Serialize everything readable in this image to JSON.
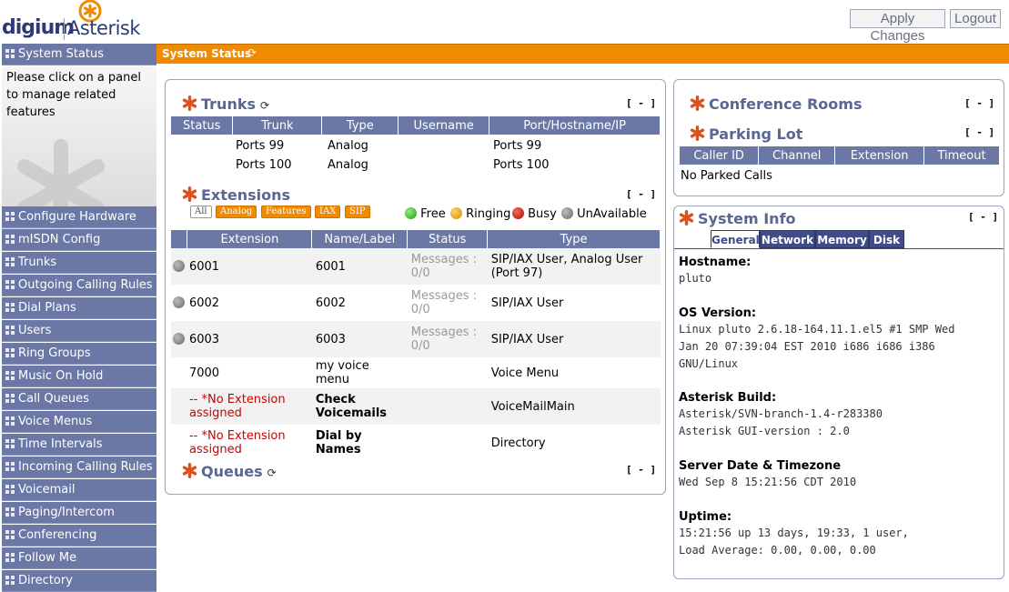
{
  "header": {
    "brand_left": "digium",
    "brand_right": "Asterisk",
    "apply_label": "Apply Changes",
    "logout_label": "Logout"
  },
  "pagebar": {
    "title": "System Status",
    "refresh_icon": "refresh-icon"
  },
  "sidebar": {
    "active": "System Status",
    "info_text": "Please click on a panel to manage related features",
    "items": [
      "Configure Hardware",
      "mISDN Config",
      "Trunks",
      "Outgoing Calling Rules",
      "Dial Plans",
      "Users",
      "Ring Groups",
      "Music On Hold",
      "Call Queues",
      "Voice Menus",
      "Time Intervals",
      "Incoming Calling Rules",
      "Voicemail",
      "Paging/Intercom",
      "Conferencing",
      "Follow Me",
      "Directory"
    ]
  },
  "collapse_label": "[ - ]",
  "trunks": {
    "title": "Trunks",
    "headers": [
      "Status",
      "Trunk",
      "Type",
      "Username",
      "Port/Hostname/IP"
    ],
    "rows": [
      {
        "status": "",
        "trunk": "Ports 99",
        "type": "Analog",
        "username": "",
        "port": "Ports 99"
      },
      {
        "status": "",
        "trunk": "Ports 100",
        "type": "Analog",
        "username": "",
        "port": "Ports 100"
      }
    ]
  },
  "extensions": {
    "title": "Extensions",
    "filters": [
      "All",
      "Analog",
      "Features",
      "IAX",
      "SIP"
    ],
    "legend": [
      "Free",
      "Ringing",
      "Busy",
      "UnAvailable"
    ],
    "headers": [
      "Extension",
      "Name/Label",
      "Status",
      "Type"
    ],
    "rows": [
      {
        "ext": "6001",
        "name": "6001",
        "status": "Messages : 0/0",
        "type": "SIP/IAX User, Analog User (Port 97)"
      },
      {
        "ext": "6002",
        "name": "6002",
        "status": "Messages : 0/0",
        "type": "SIP/IAX User"
      },
      {
        "ext": "6003",
        "name": "6003",
        "status": "Messages : 0/0",
        "type": "SIP/IAX User"
      },
      {
        "ext": "7000",
        "name": "my voice menu",
        "status": "",
        "type": "Voice Menu"
      },
      {
        "ext": "-- *No Extension assigned",
        "name": "Check Voicemails",
        "status": "",
        "type": "VoiceMailMain"
      },
      {
        "ext": "-- *No Extension assigned",
        "name": "Dial by Names",
        "status": "",
        "type": "Directory"
      }
    ],
    "messages_label": "Messages :",
    "messages_value": "0/0",
    "no_ext_prefix": "--",
    "no_ext_label": "*No Extension assigned"
  },
  "queues": {
    "title": "Queues"
  },
  "conference": {
    "title": "Conference Rooms"
  },
  "parking": {
    "title": "Parking Lot",
    "headers": [
      "Caller ID",
      "Channel",
      "Extension",
      "Timeout"
    ],
    "empty": "No Parked Calls"
  },
  "sysinfo": {
    "title": "System Info",
    "tabs": [
      "General",
      "Network",
      "Memory",
      "Disk"
    ],
    "hostname_label": "Hostname:",
    "hostname": "pluto",
    "os_label": "OS Version:",
    "os_lines": [
      "Linux pluto 2.6.18-164.11.1.el5 #1 SMP Wed",
      "Jan 20 07:39:04 EST 2010 i686 i686 i386",
      "GNU/Linux"
    ],
    "build_label": "Asterisk Build:",
    "build_lines": [
      "Asterisk/SVN-branch-1.4-r283380",
      "Asterisk GUI-version : 2.0"
    ],
    "date_label": "Server Date & Timezone",
    "date": "Wed Sep 8 15:21:56 CDT 2010",
    "uptime_label": "Uptime:",
    "uptime_lines": [
      "15:21:56 up 13 days, 19:33, 1 user,",
      "Load Average: 0.00, 0.00, 0.00"
    ]
  },
  "colors": {
    "accent": "#f08a00",
    "nav": "#6b78a6",
    "title": "#5a6693",
    "tab": "#3f4c88"
  }
}
